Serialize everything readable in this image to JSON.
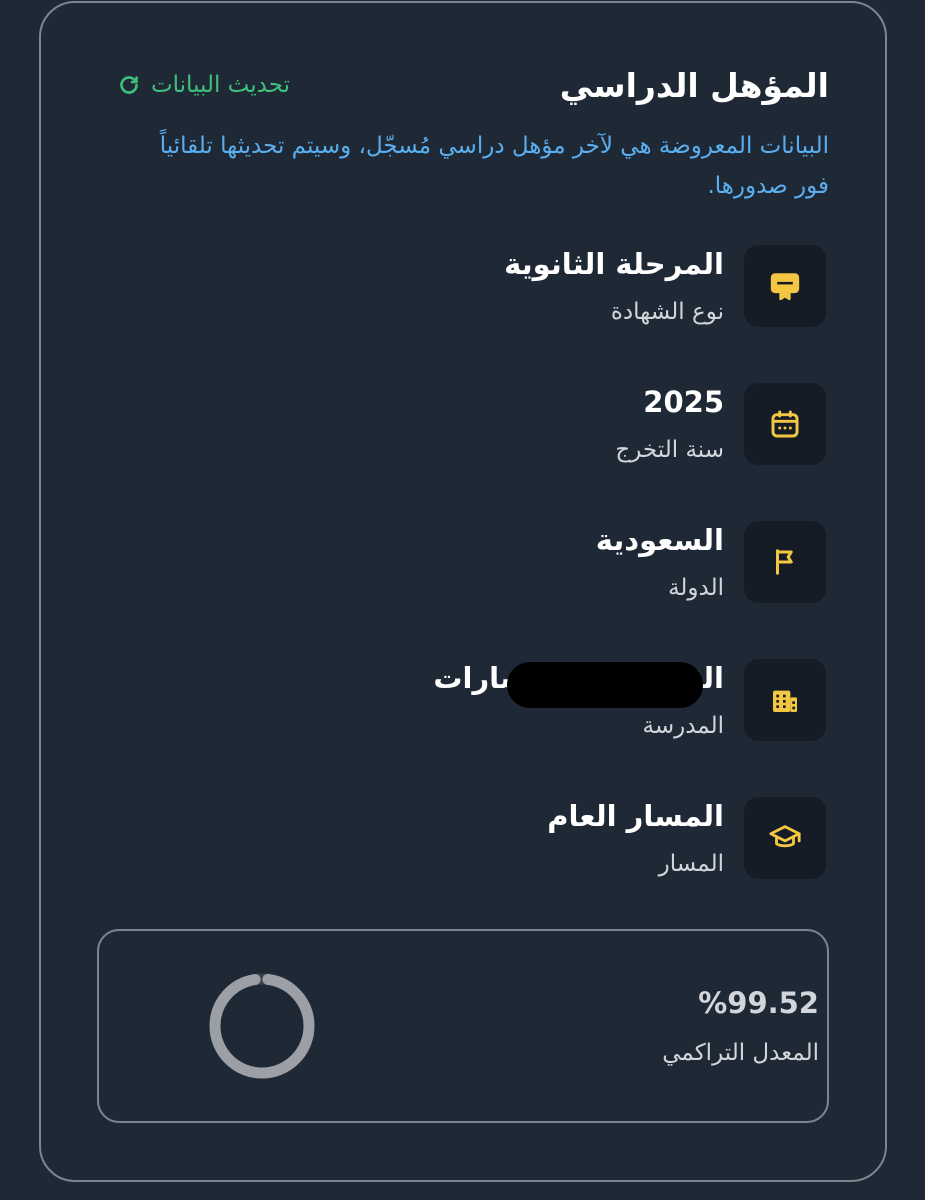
{
  "section": {
    "title": "المؤهل الدراسي",
    "refresh_label": "تحديث البيانات",
    "notice": "البيانات المعروضة هي لآخر مؤهل دراسي مُسجّل، وسيتم تحديثها تلقائياً فور صدورها."
  },
  "items": [
    {
      "value": "المرحلة الثانوية",
      "label": "نوع الشهادة",
      "icon": "certificate-icon"
    },
    {
      "value": "2025",
      "label": "سنة التخرج",
      "icon": "calendar-icon"
    },
    {
      "value": "السعودية",
      "label": "الدولة",
      "icon": "flag-icon"
    },
    {
      "value": "الثانوية ... - مسارات",
      "label": "المدرسة",
      "icon": "building-icon"
    },
    {
      "value": "المسار العام",
      "label": "المسار",
      "icon": "graduation-cap-icon"
    }
  ],
  "gpa": {
    "value": "%99.52",
    "label": "المعدل التراكمي",
    "progress": 0.9952
  },
  "colors": {
    "background": "#1f2935",
    "accent_green": "#3fc07c",
    "accent_blue": "#5aaef0",
    "icon_yellow": "#f3c742",
    "ring_gray": "#9ca0a6"
  }
}
